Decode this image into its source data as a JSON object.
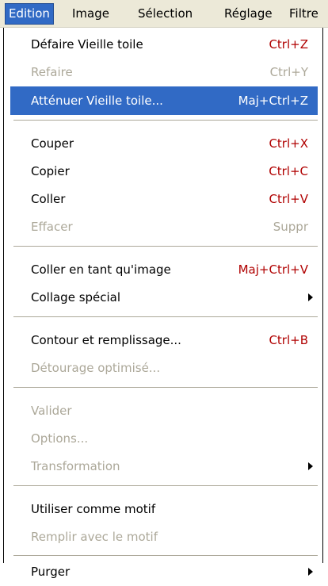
{
  "menubar": {
    "tabs": [
      "Edition",
      "Image",
      "Sélection",
      "Réglage",
      "Filtre"
    ],
    "active": "Edition"
  },
  "menu": {
    "items": [
      {
        "label": "Défaire Vieille toile",
        "shortcut": "Ctrl+Z",
        "enabled": true
      },
      {
        "label": "Refaire",
        "shortcut": "Ctrl+Y",
        "enabled": false
      },
      {
        "label": "Atténuer Vieille toile...",
        "shortcut": "Maj+Ctrl+Z",
        "enabled": true,
        "highlighted": true
      },
      {
        "label": "Couper",
        "shortcut": "Ctrl+X",
        "enabled": true
      },
      {
        "label": "Copier",
        "shortcut": "Ctrl+C",
        "enabled": true
      },
      {
        "label": "Coller",
        "shortcut": "Ctrl+V",
        "enabled": true
      },
      {
        "label": "Effacer",
        "shortcut": "Suppr",
        "enabled": false
      },
      {
        "label": "Coller en tant qu'image",
        "shortcut": "Maj+Ctrl+V",
        "enabled": true
      },
      {
        "label": "Collage spécial",
        "shortcut": "",
        "enabled": true,
        "submenu": true
      },
      {
        "label": "Contour et remplissage...",
        "shortcut": "Ctrl+B",
        "enabled": true
      },
      {
        "label": "Détourage optimisé...",
        "shortcut": "",
        "enabled": false
      },
      {
        "label": "Valider",
        "shortcut": "",
        "enabled": false
      },
      {
        "label": "Options...",
        "shortcut": "",
        "enabled": false
      },
      {
        "label": "Transformation",
        "shortcut": "",
        "enabled": false,
        "submenu": true
      },
      {
        "label": "Utiliser comme motif",
        "shortcut": "",
        "enabled": true
      },
      {
        "label": "Remplir avec le motif",
        "shortcut": "",
        "enabled": false
      },
      {
        "label": "Purger",
        "shortcut": "",
        "enabled": true,
        "submenu": true
      }
    ]
  },
  "colors": {
    "highlight": "#316ac5",
    "shortcut": "#b00000",
    "disabled": "#aca899",
    "menubar_bg": "#ece9d8"
  }
}
